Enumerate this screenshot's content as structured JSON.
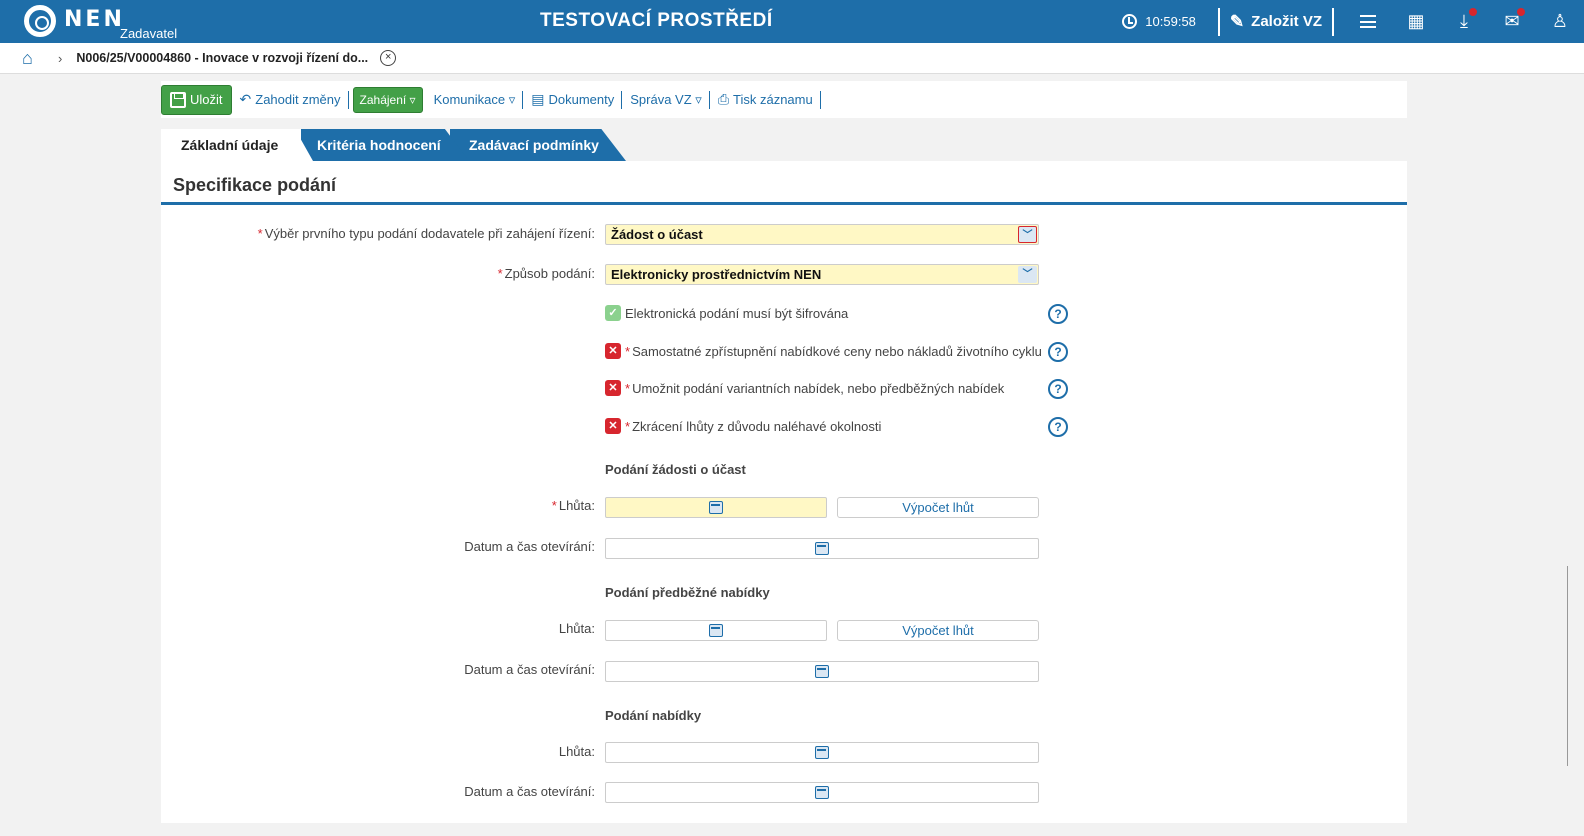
{
  "header": {
    "logo_text": "NEN",
    "logo_sub": "Zadavatel",
    "env_title": "TESTOVACÍ PROSTŘEDÍ",
    "time": "10:59:58",
    "create_label": "Založit VZ",
    "icons": [
      "clock-icon",
      "edit-icon",
      "menu-icon",
      "calendar-icon",
      "download-icon",
      "mail-icon",
      "user-icon"
    ]
  },
  "breadcrumb": {
    "text": "N006/25/V00004860 - Inovace v rozvoji řízení do...",
    "close": "×"
  },
  "toolbar": {
    "save_label": "Uložit",
    "discard_label": "Zahodit změny",
    "start_label": "Zahájení ▿",
    "communication_label": "Komunikace ▿",
    "documents_label": "Dokumenty",
    "manage_label": "Správa VZ ▿",
    "print_label": "Tisk záznamu"
  },
  "tabs": [
    "Základní údaje",
    "Kritéria hodnocení",
    "Zadávací podmínky"
  ],
  "form": {
    "title": "Specifikace podání",
    "first_type_label": "Výběr prvního typu podání dodavatele při zahájení řízení:",
    "first_type_value": "Žádost o účast",
    "method_label": "Způsob podání:",
    "method_value": "Elektronicky prostřednictvím NEN",
    "checks": [
      {
        "label": "Elektronická podání musí být šifrována",
        "required": false,
        "checked": true
      },
      {
        "label": "Samostatné zpřístupnění nabídkové ceny nebo nákladů životního cyklu",
        "required": true,
        "checked": false
      },
      {
        "label": "Umožnit podání variantních nabídek, nebo předběžných nabídek",
        "required": true,
        "checked": false
      },
      {
        "label": "Zkrácení lhůty z důvodu naléhavé okolnosti",
        "required": true,
        "checked": false
      }
    ],
    "help_glyph": "?",
    "req_star": "*",
    "check_ok_glyph": "✓",
    "check_no_glyph": "✕",
    "sections": [
      {
        "title": "Podání žádosti o účast",
        "deadline_label": "Lhůta:",
        "opening_label": "Datum a čas otevírání:",
        "calc_label": "Výpočet lhůt"
      },
      {
        "title": "Podání předběžné nabídky",
        "deadline_label": "Lhůta:",
        "opening_label": "Datum a čas otevírání:",
        "calc_label": "Výpočet lhůt"
      },
      {
        "title": "Podání nabídky",
        "deadline_label": "Lhůta:",
        "opening_label": "Datum a čas otevírání:"
      }
    ]
  },
  "colors": {
    "primary": "#1e6ea9",
    "required": "#d7262e",
    "highlight": "#fff8c5",
    "green": "#43a047"
  }
}
